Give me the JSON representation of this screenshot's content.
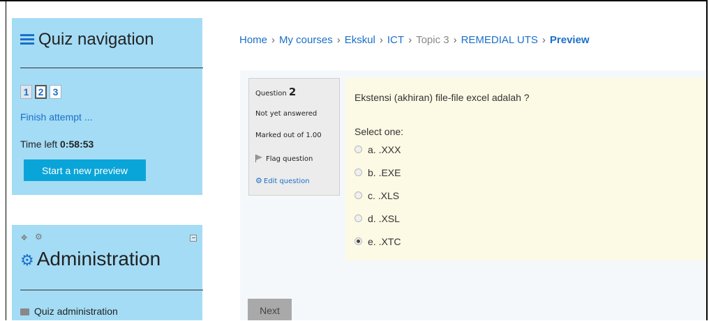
{
  "quiz_nav": {
    "title": "Quiz navigation",
    "questions": [
      "1",
      "2",
      "3"
    ],
    "finish_link": "Finish attempt ...",
    "time_left_label": "Time left",
    "time_left_value": "0:58:53",
    "start_new_preview": "Start a new preview"
  },
  "admin": {
    "title": "Administration",
    "items": [
      "Quiz administration"
    ]
  },
  "breadcrumb": {
    "items": [
      "Home",
      "My courses",
      "Ekskul",
      "ICT",
      "Topic 3",
      "REMEDIAL UTS",
      "Preview"
    ]
  },
  "question_info": {
    "question_label": "Question",
    "question_number": "2",
    "state": "Not yet answered",
    "grade": "Marked out of 1.00",
    "flag": "Flag question",
    "edit": "Edit question"
  },
  "question": {
    "text": "Ekstensi (akhiran) file-file excel adalah ?",
    "prompt": "Select one:",
    "options": [
      "a. .XXX",
      "b. .EXE",
      "c. .XLS",
      "d. .XSL",
      "e. .XTC"
    ],
    "selected_index": 4
  },
  "next_button": "Next",
  "colors": {
    "block_bg": "#a4dcf5",
    "link": "#1a6fc9",
    "primary_button": "#0aa5d8",
    "answer_bg": "#fcf9e4"
  }
}
